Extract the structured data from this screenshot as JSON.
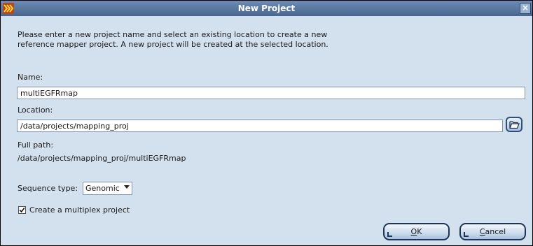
{
  "window": {
    "title": "New Project",
    "close_label": "×",
    "icon": "app-icon",
    "accent": "#48668f"
  },
  "intro": {
    "line1": "Please enter a new project name and select an existing location to create a new",
    "line2": "reference mapper project. A new project will be created at the selected location."
  },
  "name": {
    "label": "Name:",
    "value": "multiEGFRmap"
  },
  "location": {
    "label": "Location:",
    "value": "/data/projects/mapping_proj",
    "browse_icon": "folder-open-icon"
  },
  "full_path": {
    "label": "Full path:",
    "value": "/data/projects/mapping_proj/multiEGFRmap"
  },
  "sequence_type": {
    "label": "Sequence type:",
    "selected": "Genomic"
  },
  "multiplex": {
    "label": "Create a multiplex project",
    "checked": true
  },
  "buttons": {
    "ok_mnemonic": "O",
    "ok_rest": "K",
    "cancel_mnemonic": "C",
    "cancel_rest": "ancel"
  }
}
